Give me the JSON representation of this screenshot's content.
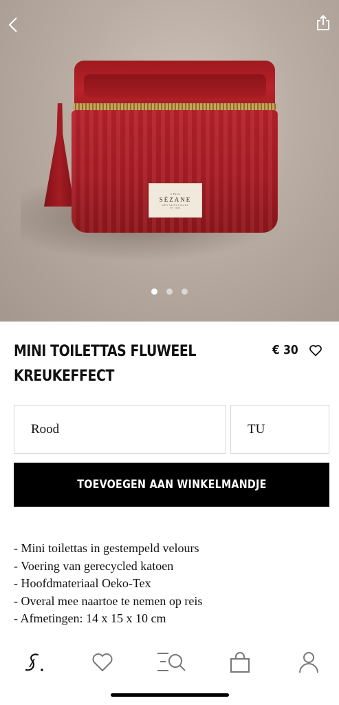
{
  "hero": {
    "label_top": "à Paris",
    "label_brand": "SÉZANE",
    "label_sub": "DEN SAINT FIACRE",
    "label_tag": "N° 2004",
    "carousel": {
      "count": 3,
      "active": 1
    }
  },
  "nav": {
    "back_icon": "chevron-left-icon",
    "share_icon": "share-icon"
  },
  "product": {
    "title": "MINI TOILETTAS FLUWEEL KREUKEFFECT",
    "price": "€ 30",
    "favorite_icon": "heart-icon"
  },
  "selectors": {
    "color": "Rood",
    "size": "TU"
  },
  "cta": {
    "add_to_cart": "TOEVOEGEN AAN WINKELMANDJE"
  },
  "description": [
    "- Mini toilettas in gestempeld velours",
    "- Voering van gerecycled katoen",
    "- Hoofdmateriaal Oeko-Tex",
    "- Overal mee naartoe te nemen op reis",
    "- Afmetingen: 14 x 15 x 10 cm"
  ],
  "tabbar": {
    "items": [
      "logo-s-icon",
      "heart-icon",
      "search-menu-icon",
      "shopping-bag-icon",
      "user-icon"
    ]
  },
  "colors": {
    "accent": "#000000",
    "product_red": "#b7222b",
    "border": "#d6d6d6"
  }
}
